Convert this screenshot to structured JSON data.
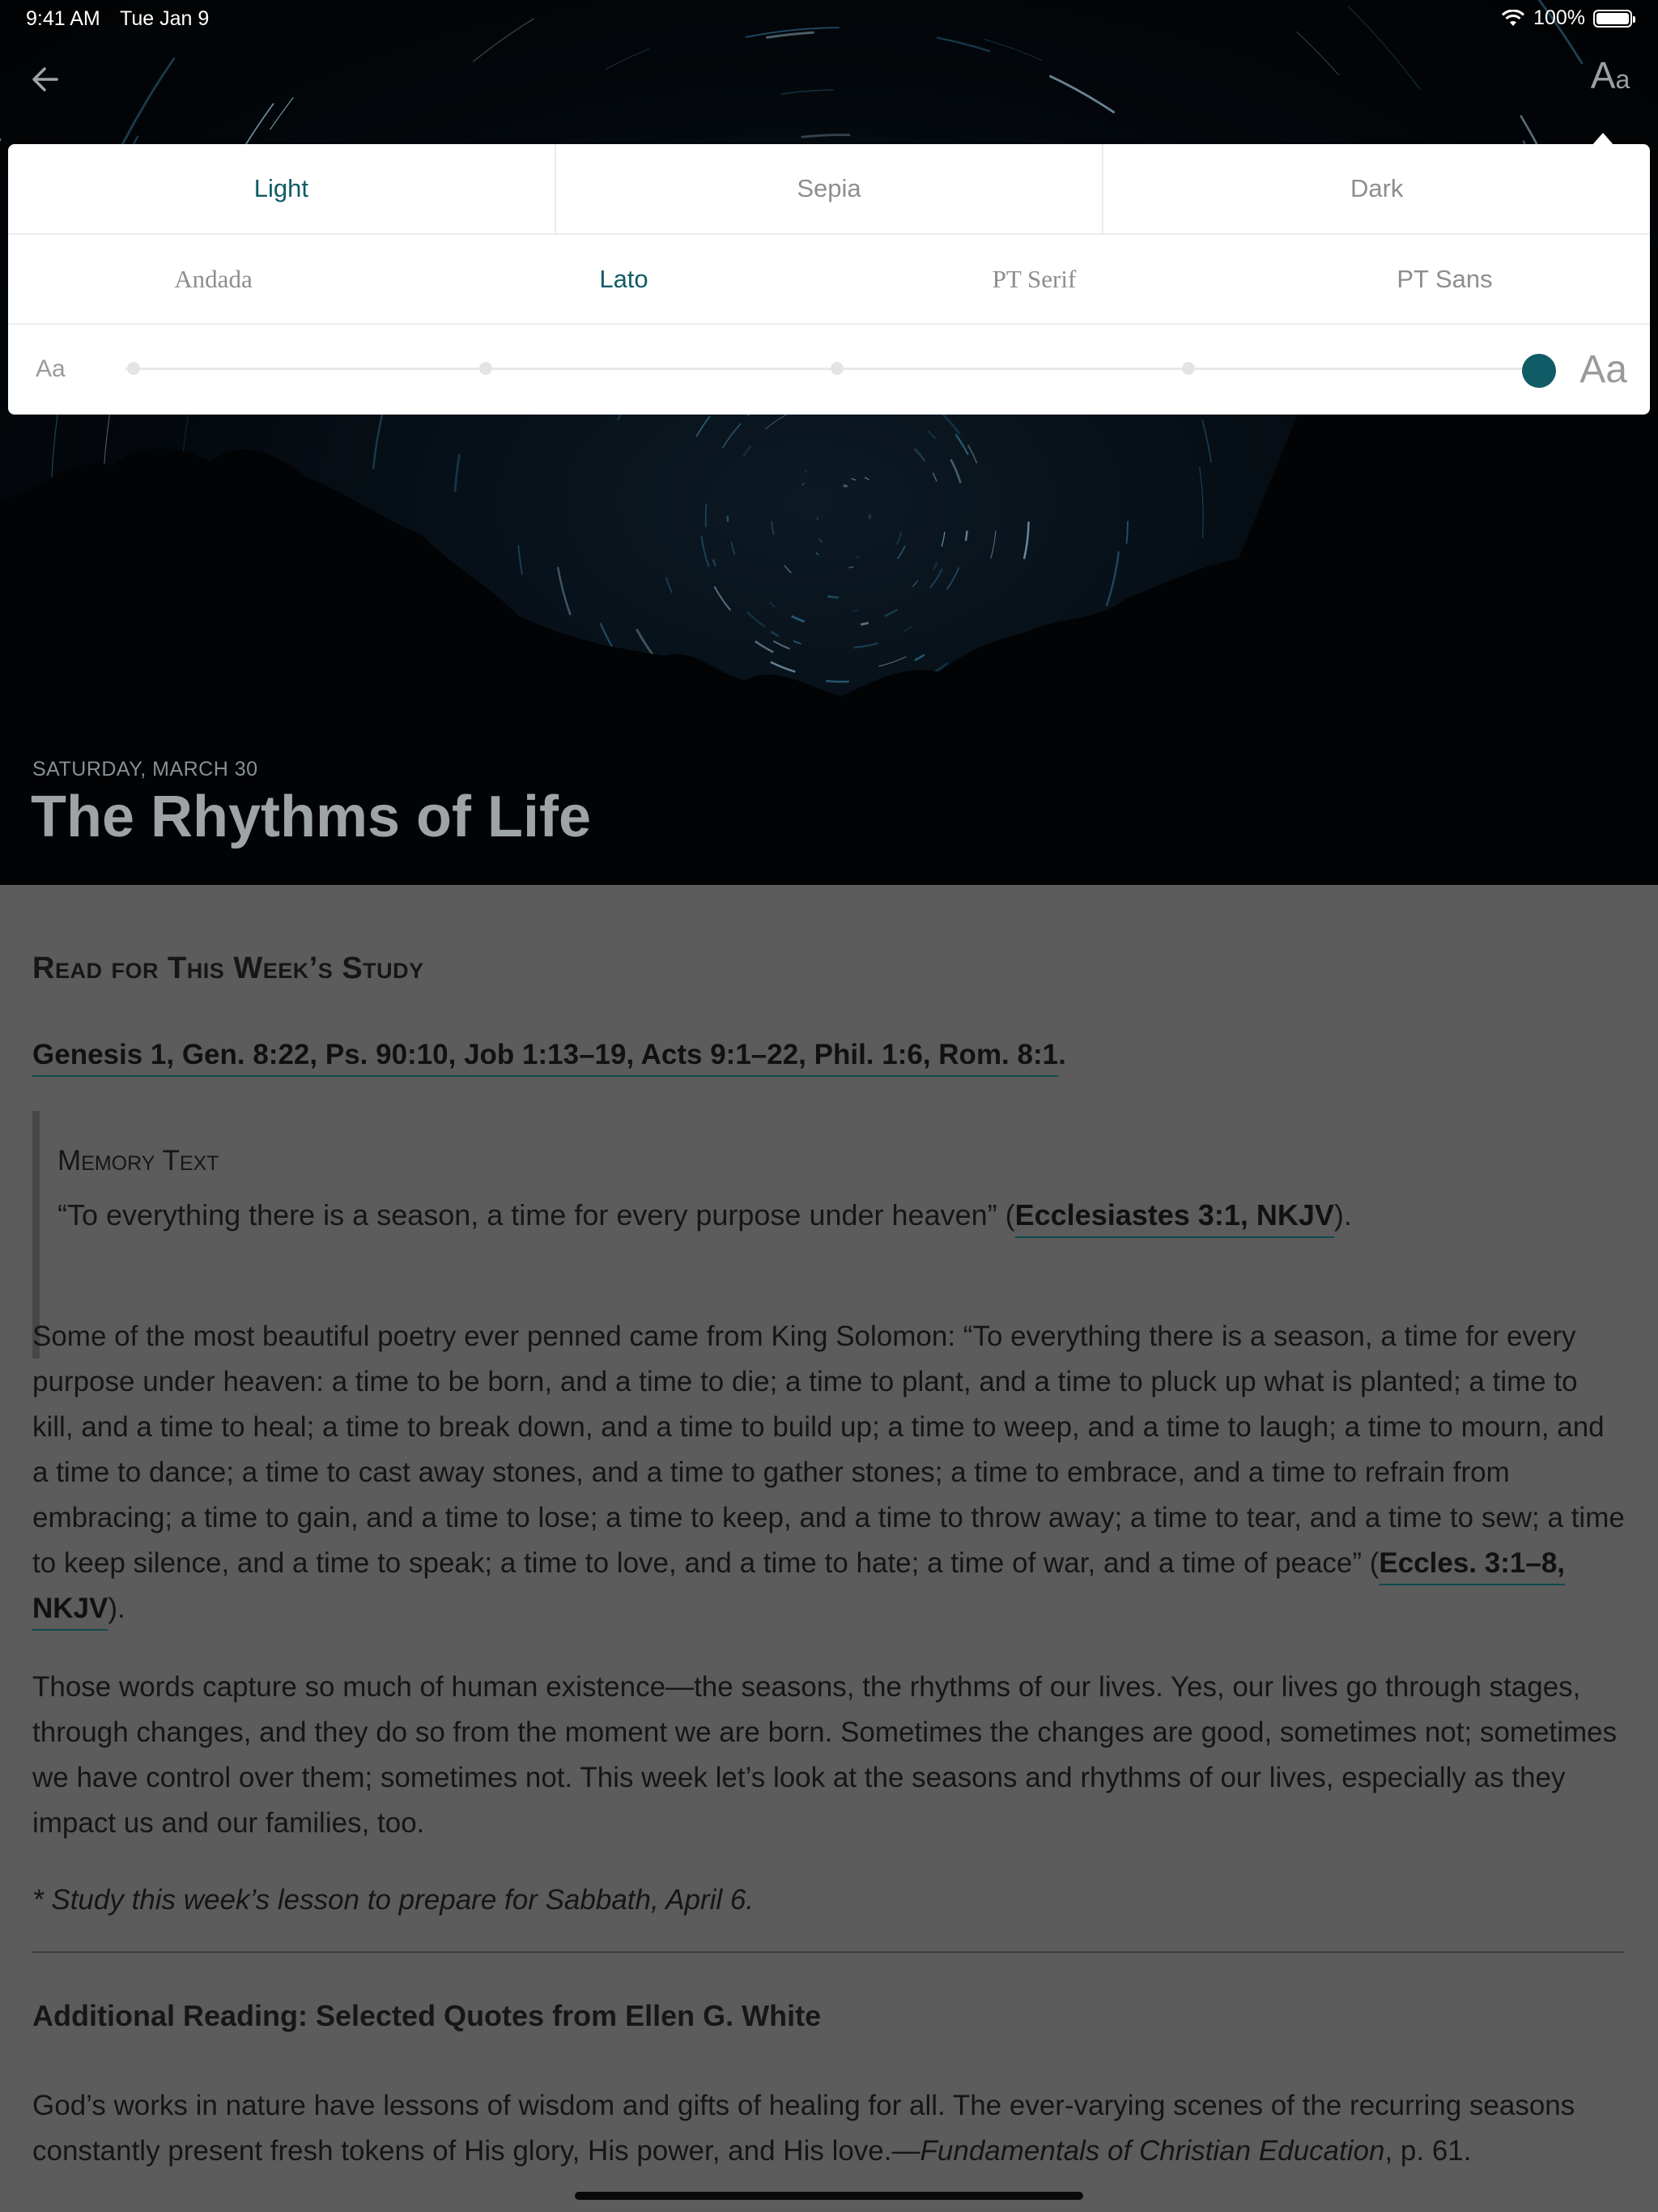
{
  "status_bar": {
    "time": "9:41 AM",
    "date": "Tue Jan 9",
    "battery": "100%"
  },
  "nav": {
    "back_icon": "arrow-left-icon",
    "font_button_large": "A",
    "font_button_small": "a"
  },
  "appearance_popover": {
    "themes": [
      "Light",
      "Sepia",
      "Dark"
    ],
    "selected_theme": "Light",
    "fonts": [
      "Andada",
      "Lato",
      "PT Serif",
      "PT Sans"
    ],
    "selected_font": "Lato",
    "size_small_label": "Aa",
    "size_large_label": "Aa",
    "size_level": 5,
    "size_levels": 5,
    "accent_color": "#0f5c66"
  },
  "hero": {
    "date": "SATURDAY, MARCH 30",
    "title": "The Rhythms of Life"
  },
  "lesson": {
    "section_heading": "Read for This Week’s Study",
    "references": "Genesis 1, Gen. 8:22, Ps. 90:10, Job 1:13–19, Acts 9:1–22, Phil. 1:6, Rom. 8:1",
    "references_end": ".",
    "memory_heading": "Memory Text",
    "memory_quote": "“To everything there is a season, a time for every purpose under heaven” (",
    "memory_ref": "Ecclesiastes 3:1, NKJV",
    "memory_end": ").",
    "para1": "Some of the most beautiful poetry ever penned came from King Solomon: “To everything there is a season, a time for every purpose under heaven: a time to be born, and a time to die; a time to plant, and a time to pluck up what is planted; a time to kill, and a time to heal; a time to break down, and a time to build up; a time to weep, and a time to laugh; a time to mourn, and a time to dance; a time to cast away stones, and a time to gather stones; a time to embrace, and a time to refrain from embracing; a time to gain, and a time to lose; a time to keep, and a time to throw away; a time to tear, and a time to sew; a time to keep silence, and a time to speak; a time to love, and a time to hate; a time of war, and a time of peace” (",
    "para1_ref": "Eccles. 3:1–8, NKJV",
    "para1_end": ").",
    "para2": "Those words capture so much of human existence—the seasons, the rhythms of our lives. Yes, our lives go through stages, through changes, and they do so from the moment we are born. Sometimes the changes are good, sometimes not; sometimes we have control over them; sometimes not. This week let’s look at the seasons and rhythms of our lives, especially as they impact us and our families, too.",
    "para3": "* Study this week’s lesson to prepare for Sabbath, April 6.",
    "additional_heading": "Additional Reading: Selected Quotes from Ellen G. White",
    "para4": "God’s works in nature have lessons of wisdom and gifts of healing for all. The ever-varying scenes of the recurring seasons constantly present fresh tokens of His glory, His power, and His love.—",
    "para4_source": "Fundamentals of Christian Education",
    "para4_end": ", p. 61."
  }
}
